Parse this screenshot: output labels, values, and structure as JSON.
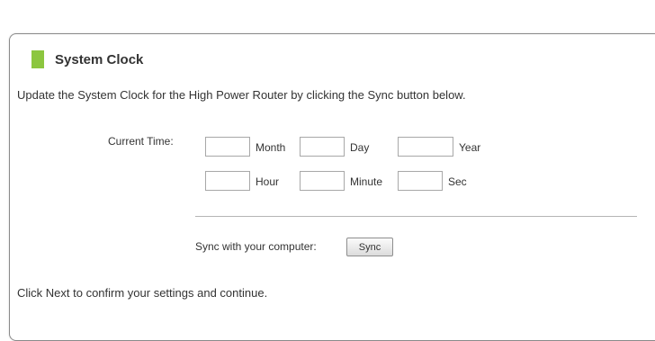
{
  "section": {
    "title": "System Clock",
    "marker_color": "#8cc63f"
  },
  "description": "Update the System Clock for the High Power Router by clicking the Sync button below.",
  "current_time": {
    "label": "Current Time:",
    "fields": {
      "month": {
        "label": "Month",
        "value": ""
      },
      "day": {
        "label": "Day",
        "value": ""
      },
      "year": {
        "label": "Year",
        "value": ""
      },
      "hour": {
        "label": "Hour",
        "value": ""
      },
      "minute": {
        "label": "Minute",
        "value": ""
      },
      "sec": {
        "label": "Sec",
        "value": ""
      }
    }
  },
  "sync": {
    "label": "Sync with your computer:",
    "button_label": "Sync"
  },
  "footer": "Click Next to confirm your settings and continue."
}
